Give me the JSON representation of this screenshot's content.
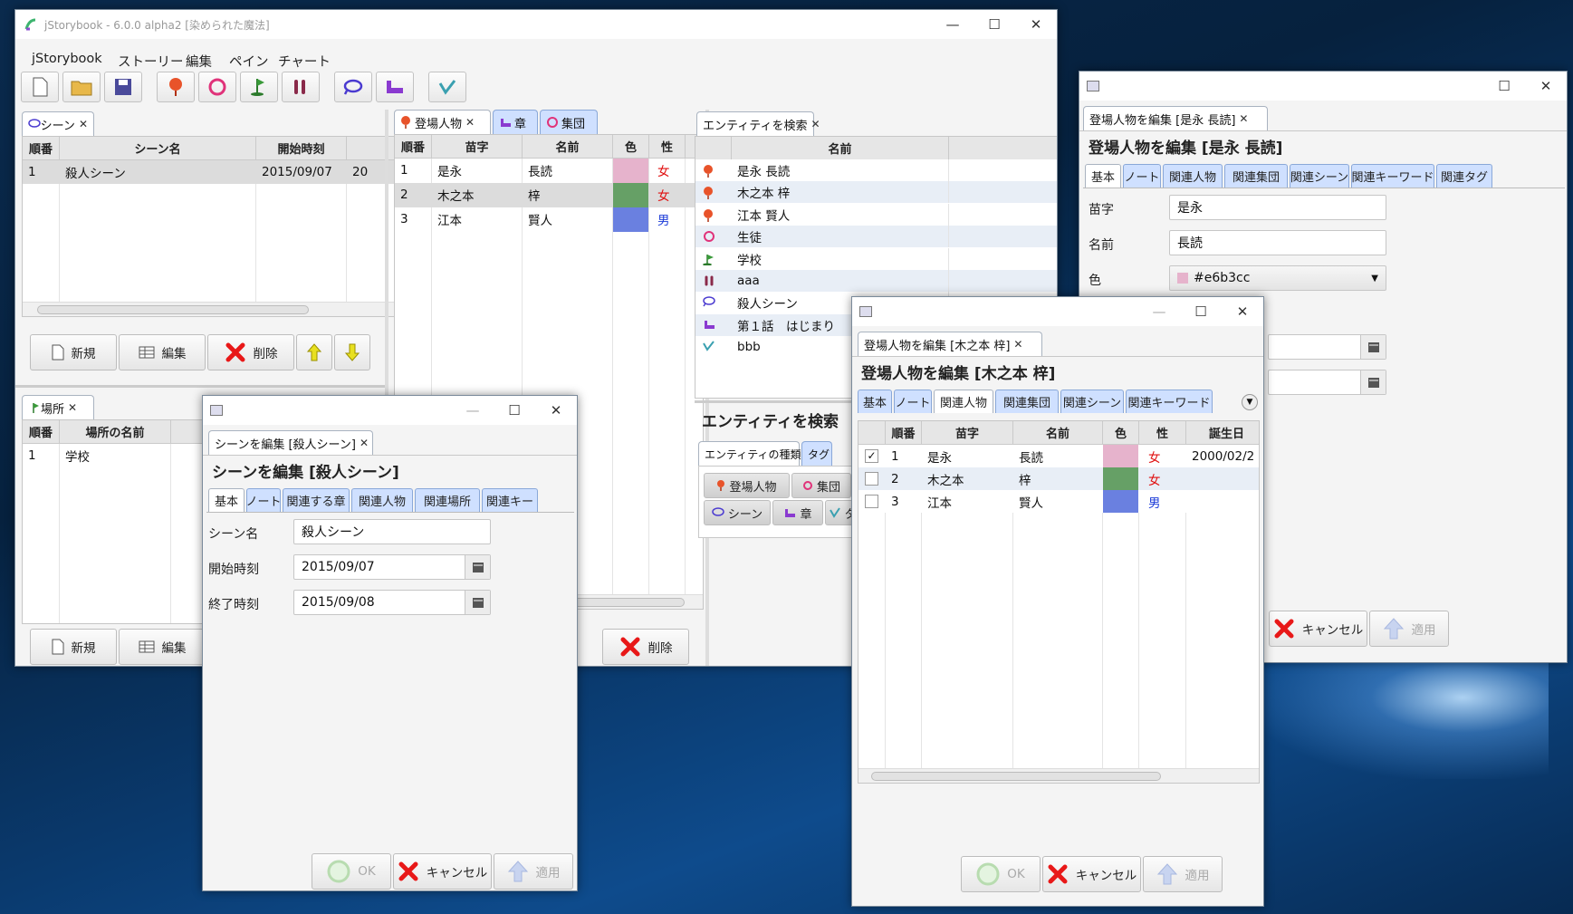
{
  "main": {
    "title": "jStorybook - 6.0.0 alpha2 [染められた魔法]",
    "menu": [
      "jStorybook",
      "ストーリー",
      "編集",
      "ペイン",
      "チャート"
    ],
    "toolbar": [
      "new-file-icon",
      "open-folder-icon",
      "save-icon",
      "person-icon",
      "group-icon",
      "location-icon",
      "item-icon",
      "scene-icon",
      "chapter-icon",
      "tag-icon"
    ],
    "scene_pane": {
      "tab": "シーン",
      "headers": [
        "順番",
        "シーン名",
        "開始時刻"
      ],
      "rows": [
        [
          "1",
          "殺人シーン",
          "2015/09/07",
          "20"
        ]
      ],
      "buttons": {
        "new": "新規",
        "edit": "編集",
        "delete": "削除"
      }
    },
    "place_pane": {
      "tab": "場所",
      "headers": [
        "順番",
        "場所の名前"
      ],
      "rows": [
        [
          "1",
          "学校"
        ]
      ],
      "buttons": {
        "new": "新規",
        "edit": "編集"
      }
    },
    "person_pane": {
      "tabs": [
        "登場人物",
        "章",
        "集団"
      ],
      "headers": [
        "順番",
        "苗字",
        "名前",
        "色",
        "性"
      ],
      "rows": [
        {
          "no": "1",
          "last": "是永",
          "first": "長読",
          "color": "#e6b3cc",
          "sex": "女",
          "sexcolor": "#e01010"
        },
        {
          "no": "2",
          "last": "木之本",
          "first": "梓",
          "color": "#66a066",
          "sex": "女",
          "sexcolor": "#e01010"
        },
        {
          "no": "3",
          "last": "江本",
          "first": "賢人",
          "color": "#6a80e0",
          "sex": "男",
          "sexcolor": "#1a3ad8"
        }
      ],
      "delete": "削除"
    },
    "search_pane": {
      "tab": "エンティティを検索",
      "header": "名前",
      "rows": [
        {
          "icon": "person",
          "name": "是永 長読"
        },
        {
          "icon": "person",
          "name": "木之本 梓"
        },
        {
          "icon": "person",
          "name": "江本 賢人"
        },
        {
          "icon": "group",
          "name": "生徒"
        },
        {
          "icon": "location",
          "name": "学校"
        },
        {
          "icon": "item",
          "name": "aaa"
        },
        {
          "icon": "scene",
          "name": "殺人シーン"
        },
        {
          "icon": "chapter",
          "name": "第１話　はじまり"
        },
        {
          "icon": "tag",
          "name": "bbb"
        }
      ],
      "heading": "エンティティを検索",
      "subtabs": [
        "エンティティの種類",
        "タグ"
      ],
      "types": [
        "登場人物",
        "集団",
        "シーン",
        "章",
        "タ"
      ]
    }
  },
  "scene_dialog": {
    "tab": "シーンを編集 [殺人シーン]",
    "heading": "シーンを編集 [殺人シーン]",
    "tabs": [
      "基本",
      "ノート",
      "関連する章",
      "関連人物",
      "関連場所",
      "関連キー"
    ],
    "fields": {
      "name_label": "シーン名",
      "name_value": "殺人シーン",
      "start_label": "開始時刻",
      "start_value": "2015/09/07",
      "end_label": "終了時刻",
      "end_value": "2015/09/08"
    },
    "buttons": {
      "ok": "OK",
      "cancel": "キャンセル",
      "apply": "適用"
    }
  },
  "person_dialog_1": {
    "tab": "登場人物を編集 [是永 長読]",
    "heading": "登場人物を編集 [是永 長読]",
    "tabs": [
      "基本",
      "ノート",
      "関連人物",
      "関連集団",
      "関連シーン",
      "関連キーワード",
      "関連タグ"
    ],
    "fields": {
      "last_label": "苗字",
      "last_value": "是永",
      "first_label": "名前",
      "first_value": "長読",
      "color_label": "色",
      "color_value": "#e6b3cc"
    },
    "buttons": {
      "cancel": "キャンセル",
      "apply": "適用"
    }
  },
  "person_dialog_2": {
    "tab": "登場人物を編集 [木之本 梓]",
    "heading": "登場人物を編集 [木之本 梓]",
    "tabs": [
      "基本",
      "ノート",
      "関連人物",
      "関連集団",
      "関連シーン",
      "関連キーワード"
    ],
    "headers": [
      "順番",
      "苗字",
      "名前",
      "色",
      "性",
      "誕生日"
    ],
    "rows": [
      {
        "checked": "✓",
        "no": "1",
        "last": "是永",
        "first": "長読",
        "color": "#e6b3cc",
        "sex": "女",
        "sexcolor": "#e01010",
        "birth": "2000/02/2"
      },
      {
        "checked": "",
        "no": "2",
        "last": "木之本",
        "first": "梓",
        "color": "#66a066",
        "sex": "女",
        "sexcolor": "#e01010",
        "birth": ""
      },
      {
        "checked": "",
        "no": "3",
        "last": "江本",
        "first": "賢人",
        "color": "#6a80e0",
        "sex": "男",
        "sexcolor": "#1a3ad8",
        "birth": ""
      }
    ],
    "buttons": {
      "ok": "OK",
      "cancel": "キャンセル",
      "apply": "適用"
    }
  }
}
